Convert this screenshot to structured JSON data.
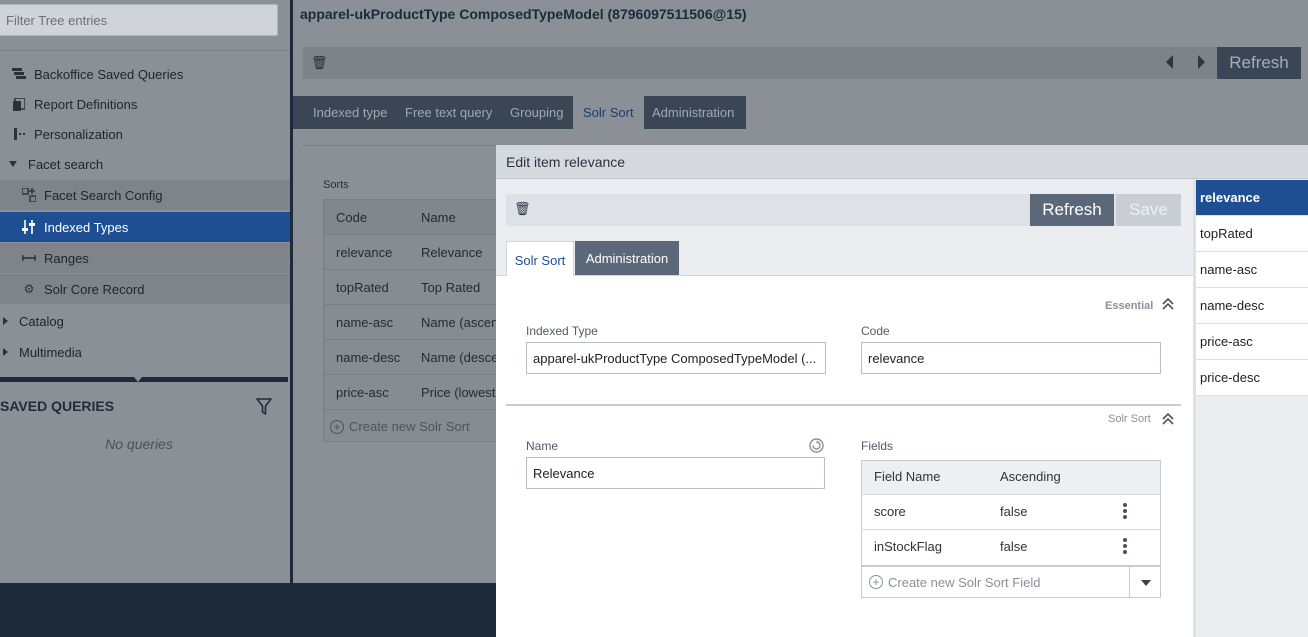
{
  "left_panel": {
    "filter_placeholder": "Filter Tree entries",
    "tree": [
      {
        "label": "Backoffice Saved Queries",
        "icon": "saved-queries-icon"
      },
      {
        "label": "Report Definitions",
        "icon": "report-icon"
      },
      {
        "label": "Personalization",
        "icon": "personalization-icon"
      },
      {
        "label": "Facet search",
        "icon": "caret-down-icon"
      },
      {
        "label": "Facet Search Config",
        "icon": "facet-config-icon"
      },
      {
        "label": "Indexed Types",
        "icon": "indexed-types-icon"
      },
      {
        "label": "Ranges",
        "icon": "ranges-icon"
      },
      {
        "label": "Solr Core Record",
        "icon": "gear-icon"
      },
      {
        "label": "Catalog",
        "icon": "caret-right-icon"
      },
      {
        "label": "Multimedia",
        "icon": "caret-right-icon"
      }
    ],
    "saved_queries_title": "SAVED QUERIES",
    "no_queries": "No queries"
  },
  "main": {
    "title": "apparel-ukProductType ComposedTypeModel (8796097511506@15)",
    "refresh_label": "Refresh",
    "tabs": [
      "Indexed type",
      "Free text query",
      "Grouping",
      "Solr Sort",
      "Administration"
    ],
    "selected_tab": "Solr Sort",
    "sorts_label": "Sorts",
    "sorts_columns": [
      "Code",
      "Name"
    ],
    "sorts_rows": [
      {
        "code": "relevance",
        "name": "Relevance"
      },
      {
        "code": "topRated",
        "name": "Top Rated"
      },
      {
        "code": "name-asc",
        "name": "Name (ascending)"
      },
      {
        "code": "name-desc",
        "name": "Name (descending)"
      },
      {
        "code": "price-asc",
        "name": "Price (lowest first)"
      }
    ],
    "create_sort_label": "Create new Solr Sort"
  },
  "dialog": {
    "title": "Edit item relevance",
    "refresh_label": "Refresh",
    "save_label": "Save",
    "tabs": [
      "Solr Sort",
      "Administration"
    ],
    "section_essential": "Essential",
    "indexed_type_label": "Indexed Type",
    "indexed_type_value": "apparel-ukProductType ComposedTypeModel (...",
    "code_label": "Code",
    "code_value": "relevance",
    "section_solr_sort": "Solr Sort",
    "name_label": "Name",
    "name_value": "Relevance",
    "fields_label": "Fields",
    "fields_columns": [
      "Field Name",
      "Ascending"
    ],
    "fields_rows": [
      {
        "field": "score",
        "ascending": "false"
      },
      {
        "field": "inStockFlag",
        "ascending": "false"
      }
    ],
    "create_field_label": "Create new Solr Sort Field"
  },
  "right_list": {
    "items": [
      "relevance",
      "topRated",
      "name-asc",
      "name-desc",
      "price-asc",
      "price-desc"
    ],
    "selected": "relevance"
  },
  "colors": {
    "accent": "#1f4f93",
    "dark_bar": "#5b6879",
    "navy": "#1d2a3a"
  }
}
